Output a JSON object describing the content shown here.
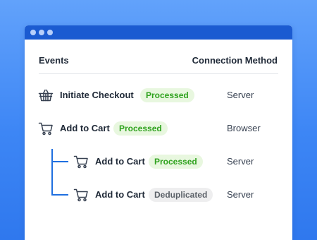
{
  "colors": {
    "background": "#3d86f5",
    "titlebar": "#1b5bd1",
    "processed_text": "#2fa21e",
    "processed_bg": "#e8f7df",
    "deduplicated_text": "#5b6168",
    "deduplicated_bg": "#eeeeef",
    "tree_line": "#1f6fe0"
  },
  "table": {
    "headers": {
      "events": "Events",
      "connection_method": "Connection Method"
    },
    "rows": [
      {
        "icon": "basket-icon",
        "event": "Initiate Checkout",
        "status": "Processed",
        "method": "Server",
        "nested": false
      },
      {
        "icon": "cart-icon",
        "event": "Add to Cart",
        "status": "Processed",
        "method": "Browser",
        "nested": false
      },
      {
        "icon": "cart-icon",
        "event": "Add to Cart",
        "status": "Processed",
        "method": "Server",
        "nested": true
      },
      {
        "icon": "cart-icon",
        "event": "Add to Cart",
        "status": "Deduplicated",
        "method": "Server",
        "nested": true
      }
    ]
  }
}
